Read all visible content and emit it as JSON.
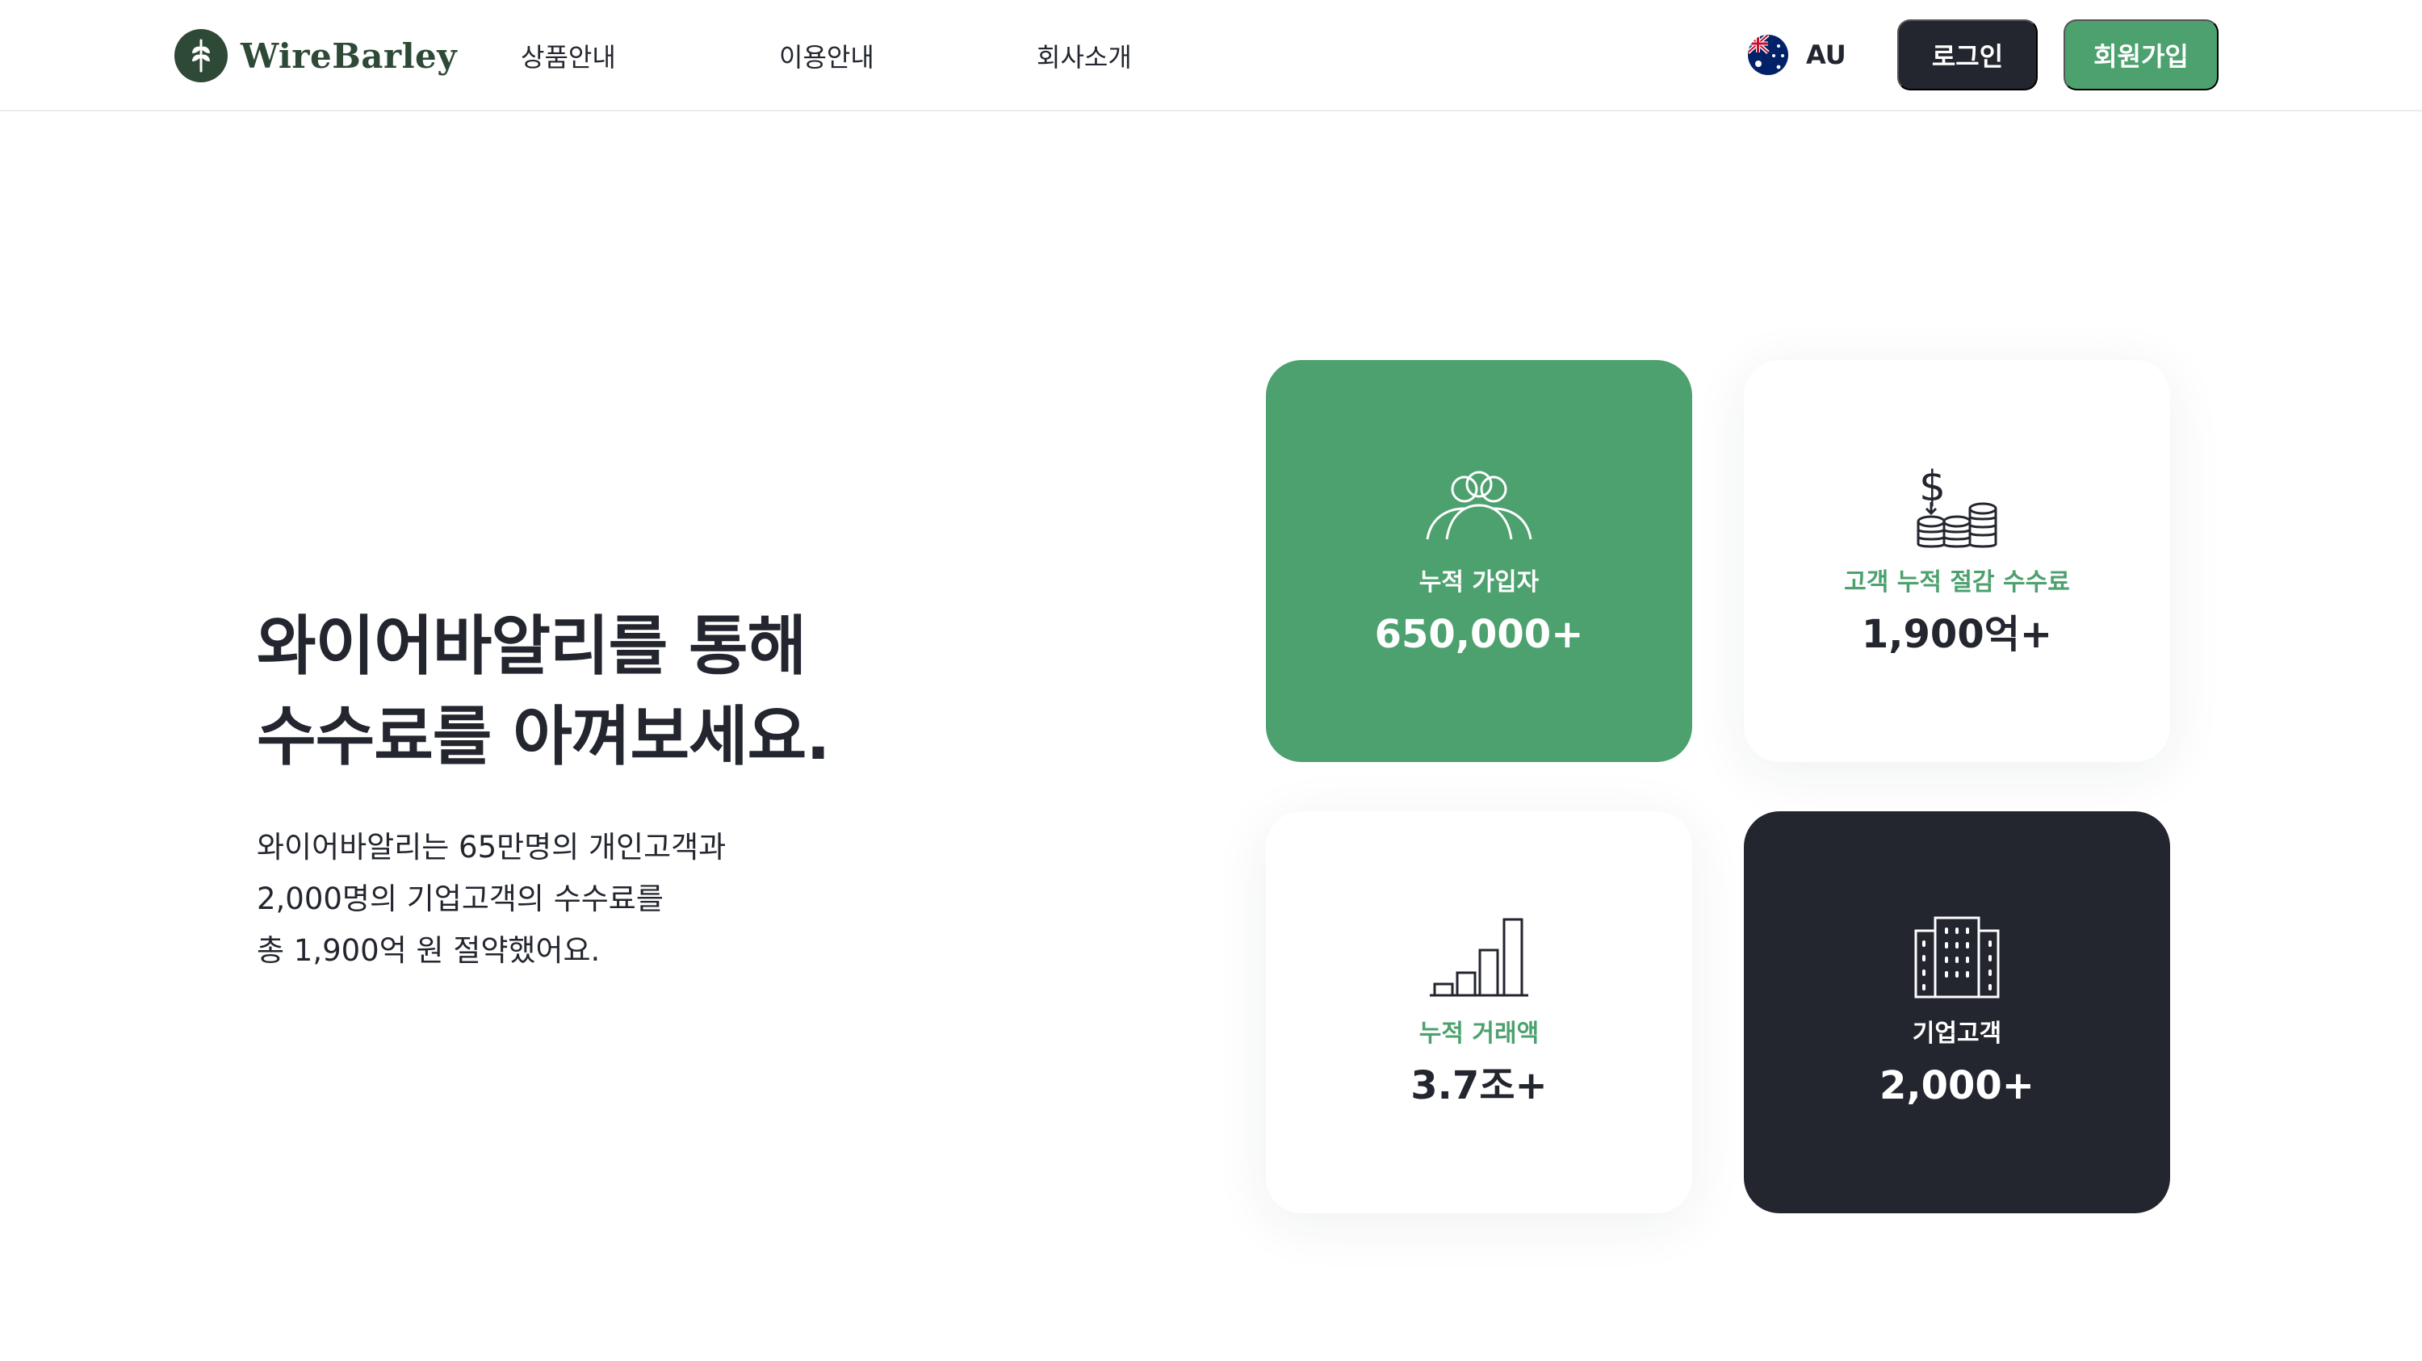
{
  "brand": {
    "name": "WireBarley",
    "logo_color": "#2e4a37"
  },
  "nav": {
    "items": [
      {
        "label": "상품안내"
      },
      {
        "label": "이용안내"
      },
      {
        "label": "회사소개"
      }
    ]
  },
  "region": {
    "code": "AU",
    "flag_icon": "australia-flag-icon"
  },
  "auth": {
    "login_label": "로그인",
    "signup_label": "회원가입"
  },
  "hero": {
    "title_lines": [
      "와이어바알리를 통해",
      "수수료를 아껴보세요."
    ],
    "description_lines": [
      "와이어바알리는 65만명의 개인고객과",
      "2,000명의 기업고객의 수수료를",
      "총 1,900억 원 절약했어요."
    ]
  },
  "stats": [
    {
      "icon": "users-group-icon",
      "label": "누적 가입자",
      "value": "650,000+",
      "theme": "green"
    },
    {
      "icon": "dollar-coins-icon",
      "label": "고객 누적 절감 수수료",
      "value": "1,900억+",
      "theme": "white"
    },
    {
      "icon": "bar-chart-icon",
      "label": "누적 거래액",
      "value": "3.7조+",
      "theme": "white"
    },
    {
      "icon": "office-building-icon",
      "label": "기업고객",
      "value": "2,000+",
      "theme": "dark"
    }
  ],
  "colors": {
    "accent_green": "#4ca16e",
    "dark": "#23262f",
    "text": "#23262f",
    "divider": "#e9ebee"
  }
}
